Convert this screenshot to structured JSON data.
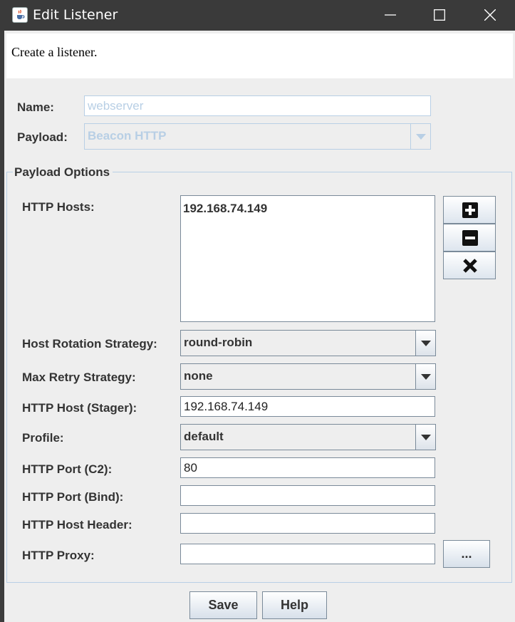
{
  "window": {
    "title": "Edit Listener",
    "controls": [
      "minimize",
      "maximize",
      "close"
    ]
  },
  "description": "Create a listener.",
  "name": {
    "label": "Name:",
    "value": "webserver"
  },
  "payload": {
    "label": "Payload:",
    "value": "Beacon HTTP"
  },
  "payload_options": {
    "title": "Payload Options",
    "http_hosts": {
      "label": "HTTP Hosts:",
      "items": [
        "192.168.74.149"
      ],
      "buttons": [
        "plus-icon",
        "minus-icon",
        "x-icon"
      ]
    },
    "host_rotation": {
      "label": "Host Rotation Strategy:",
      "value": "round-robin"
    },
    "max_retry": {
      "label": "Max Retry Strategy:",
      "value": "none"
    },
    "host_stager": {
      "label": "HTTP Host (Stager):",
      "value": "192.168.74.149"
    },
    "profile": {
      "label": "Profile:",
      "value": "default"
    },
    "port_c2": {
      "label": "HTTP Port (C2):",
      "value": "80"
    },
    "port_bind": {
      "label": "HTTP Port (Bind):",
      "value": ""
    },
    "host_header": {
      "label": "HTTP Host Header:",
      "value": ""
    },
    "proxy": {
      "label": "HTTP Proxy:",
      "value": "",
      "button": "..."
    }
  },
  "buttons": {
    "save": "Save",
    "help": "Help"
  }
}
